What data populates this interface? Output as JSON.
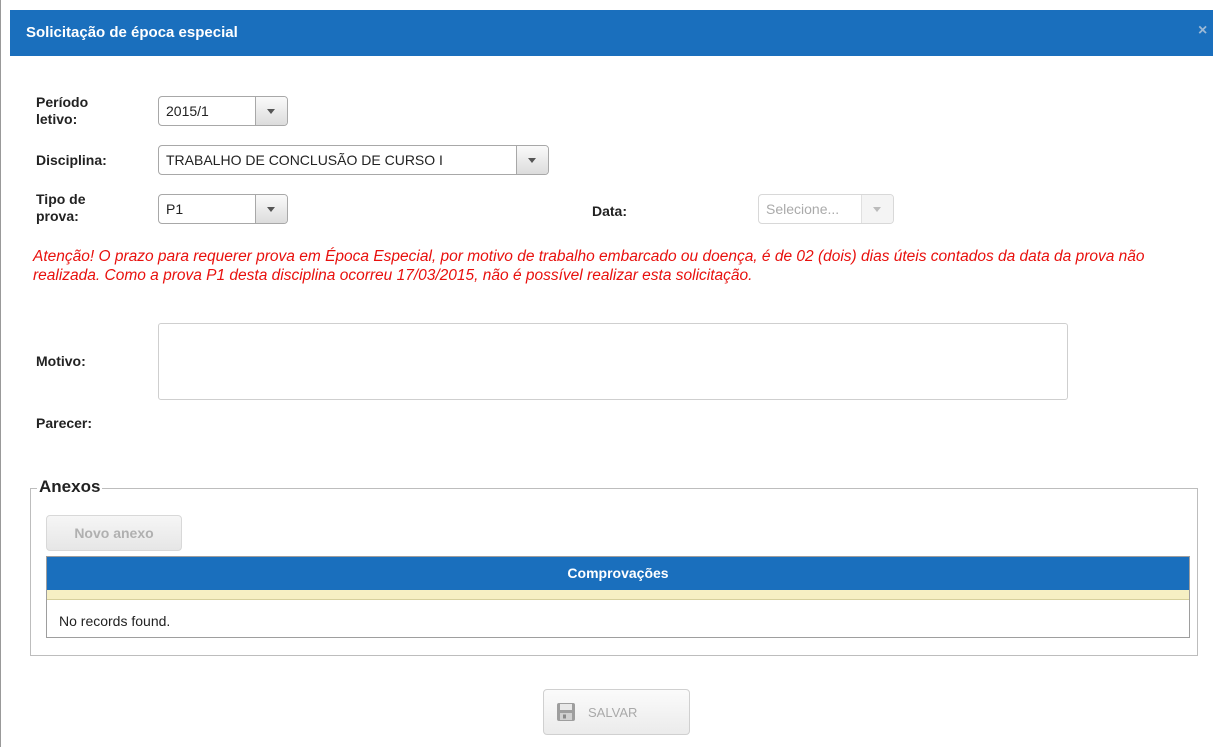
{
  "dialog": {
    "title": "Solicitação de época especial",
    "close_glyph": "×"
  },
  "form": {
    "periodo_label_line1": "Período",
    "periodo_label_line2": "letivo:",
    "periodo_value": "2015/1",
    "disciplina_label": "Disciplina:",
    "disciplina_value": "TRABALHO DE CONCLUSÃO DE CURSO I",
    "tipo_label_line1": "Tipo de",
    "tipo_label_line2": "prova:",
    "tipo_value": "P1",
    "data_label": "Data:",
    "data_placeholder": "Selecione...",
    "warning": "Atenção! O prazo para requerer prova em Época Especial, por motivo de trabalho embarcado ou doença, é de 02 (dois) dias úteis contados da data da prova não realizada. Como a prova P1 desta disciplina ocorreu 17/03/2015, não é possível realizar esta solicitação.",
    "motivo_label": "Motivo:",
    "parecer_label": "Parecer:"
  },
  "anexos": {
    "legend": "Anexos",
    "novo_anexo_label": "Novo anexo",
    "grid_header": "Comprovações",
    "empty_message": "No records found."
  },
  "footer": {
    "save_label": "SALVAR"
  },
  "colors": {
    "header_blue": "#1a6fbd",
    "warning_red": "#e8100d",
    "empty_band": "#f6efc3"
  },
  "icons": {
    "close": "close-icon",
    "dropdown": "chevron-down-icon",
    "save": "floppy-disk-icon"
  }
}
